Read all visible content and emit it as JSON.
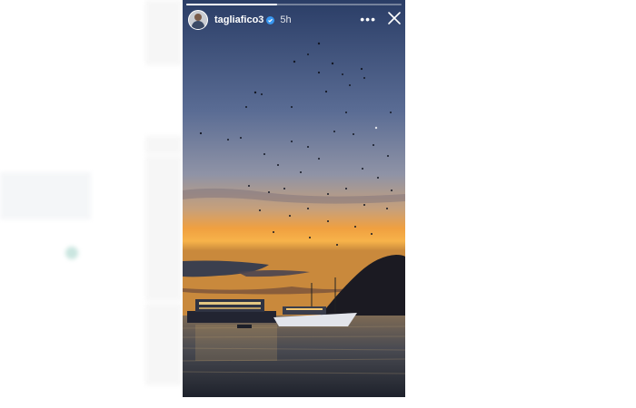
{
  "story": {
    "username": "tagliafico3",
    "time": "5h",
    "progress": 0.42,
    "icons": {
      "verified": "verified-badge-icon",
      "more": "more-options-icon",
      "close": "close-icon"
    }
  },
  "colors": {
    "sky_top": "#2a3d66",
    "sky_mid": "#6d7ea2",
    "horizon": "#f09a3a",
    "water": "#2a2f3b"
  }
}
